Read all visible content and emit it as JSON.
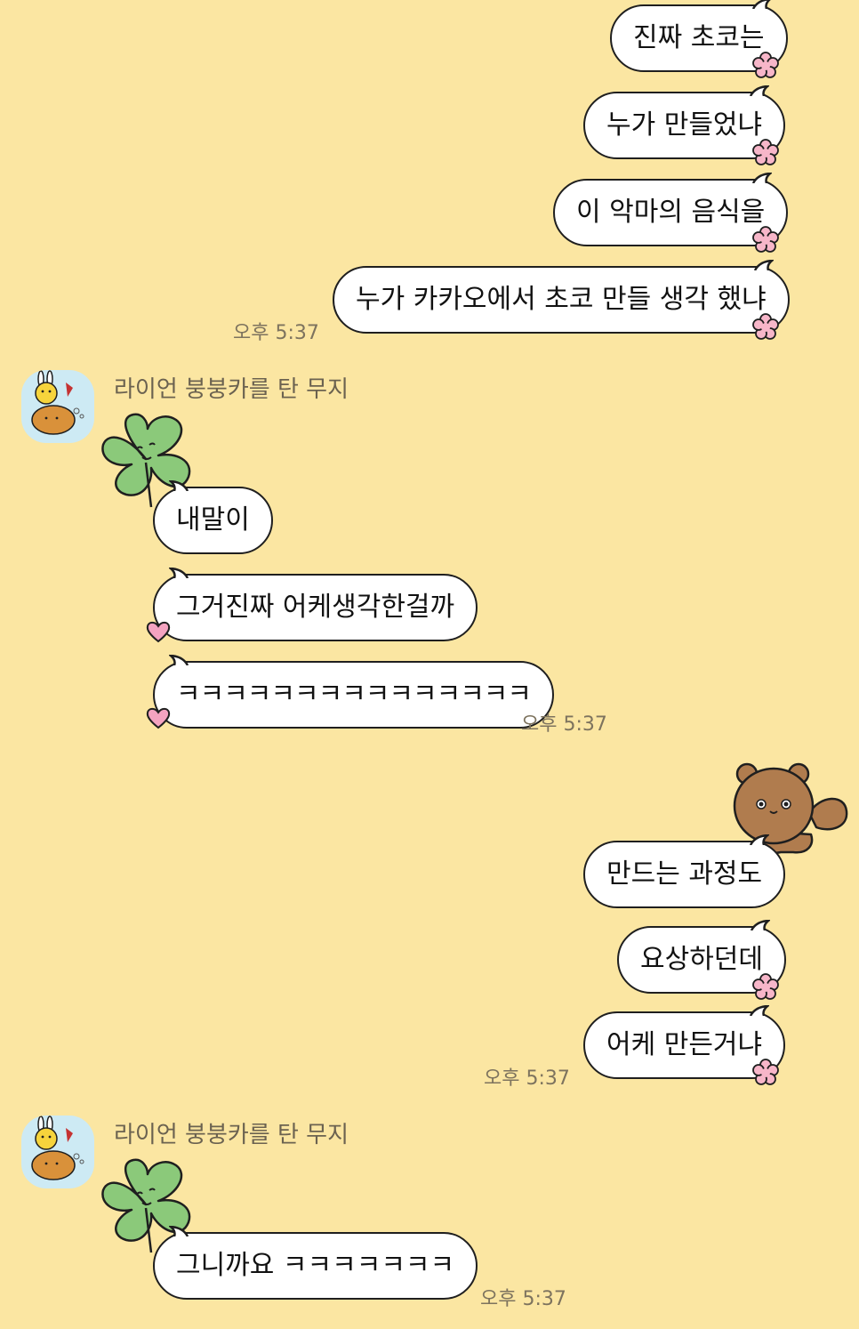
{
  "colors": {
    "background": "#FBE6A2",
    "bubble": "#ffffff",
    "outline": "#1f1f1f",
    "flower": "#F7B6C9",
    "heart": "#F4A3C0",
    "clover": "#8BC97A",
    "bear": "#B07C4E"
  },
  "messages": {
    "group1": {
      "m1": "진짜 초코는",
      "m2": "누가 만들었냐",
      "m3": "이 악마의 음식을",
      "m4": "누가 카카오에서 초코 만들 생각 했냐",
      "time": "오후 5:37"
    },
    "group2": {
      "sender": "라이언 붕붕카를 탄 무지",
      "m1": "내말이",
      "m2": "그거진짜 어케생각한걸까",
      "m3": "ㅋㅋㅋㅋㅋㅋㅋㅋㅋㅋㅋㅋㅋㅋㅋ",
      "time": "오후 5:37"
    },
    "group3": {
      "m1": "만드는 과정도",
      "m2": "요상하던데",
      "m3": "어케 만든거냐",
      "time": "오후 5:37"
    },
    "group4": {
      "sender": "라이언 붕붕카를 탄 무지",
      "m1": "그니까요 ㅋㅋㅋㅋㅋㅋㅋ",
      "time": "오후 5:37"
    }
  },
  "icons": {
    "avatar": "muzi-riding-ryan-avatar",
    "clover": "clover-sticker-icon",
    "bear": "bear-sticker-icon",
    "flower": "flower-icon",
    "heart": "heart-icon"
  }
}
